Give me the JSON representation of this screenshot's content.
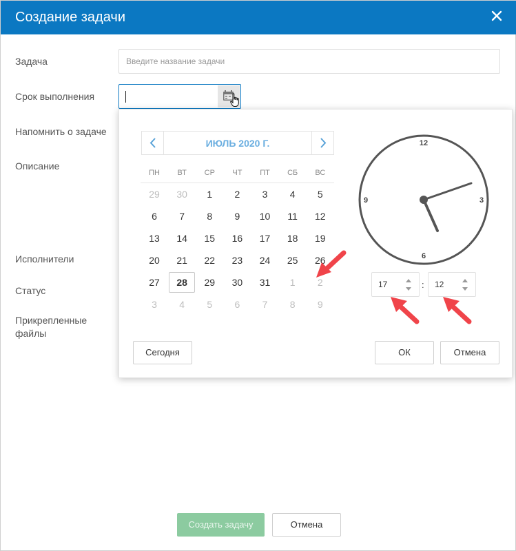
{
  "header": {
    "title": "Создание задачи"
  },
  "form": {
    "task_label": "Задача",
    "task_placeholder": "Введите название задачи",
    "deadline_label": "Срок выполнения",
    "remind_label": "Напомнить о задаче",
    "description_label": "Описание",
    "assignees_label": "Исполнители",
    "status_label": "Статус",
    "attachments_label_1": "Прикрепленные",
    "attachments_label_2": "файлы"
  },
  "picker": {
    "month_title": "ИЮЛЬ 2020 Г.",
    "weekdays": [
      "ПН",
      "ВТ",
      "СР",
      "ЧТ",
      "ПТ",
      "СБ",
      "ВС"
    ],
    "weeks": [
      [
        "29",
        "30",
        "1",
        "2",
        "3",
        "4",
        "5"
      ],
      [
        "6",
        "7",
        "8",
        "9",
        "10",
        "11",
        "12"
      ],
      [
        "13",
        "14",
        "15",
        "16",
        "17",
        "18",
        "19"
      ],
      [
        "20",
        "21",
        "22",
        "23",
        "24",
        "25",
        "26"
      ],
      [
        "27",
        "28",
        "29",
        "30",
        "31",
        "1",
        "2"
      ],
      [
        "3",
        "4",
        "5",
        "6",
        "7",
        "8",
        "9"
      ]
    ],
    "muted_cells": [
      [
        0,
        0
      ],
      [
        0,
        1
      ],
      [
        4,
        5
      ],
      [
        4,
        6
      ],
      [
        5,
        0
      ],
      [
        5,
        1
      ],
      [
        5,
        2
      ],
      [
        5,
        3
      ],
      [
        5,
        4
      ],
      [
        5,
        5
      ],
      [
        5,
        6
      ]
    ],
    "selected_cell": [
      4,
      1
    ],
    "today_button": "Сегодня",
    "ok_button": "ОК",
    "cancel_button": "Отмена",
    "clock_labels": {
      "n12": "12",
      "n3": "3",
      "n6": "6",
      "n9": "9"
    },
    "hour_value": "17",
    "minute_value": "12",
    "time_separator": ":"
  },
  "footer": {
    "create_button": "Создать задачу",
    "cancel_button": "Отмена"
  },
  "colors": {
    "header_bg": "#0b78c2",
    "month_title": "#6aaee0",
    "create_button_bg": "#8ccba0",
    "annotation_arrow": "#f0444a"
  }
}
